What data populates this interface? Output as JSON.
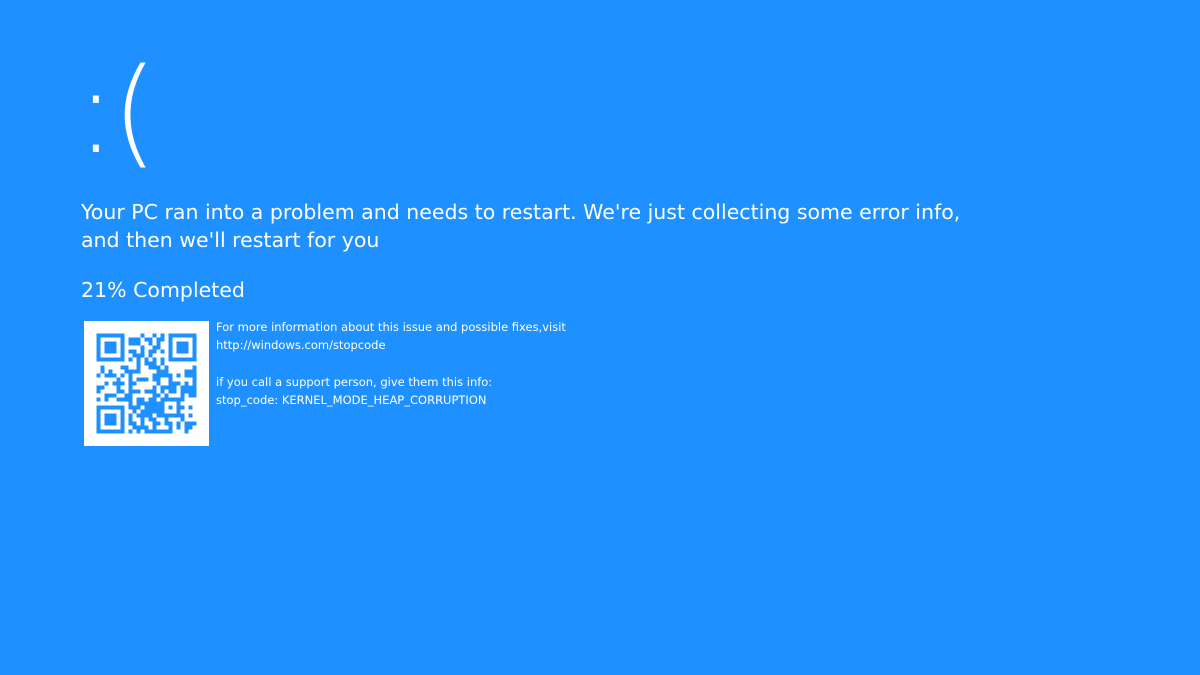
{
  "colors": {
    "background": "#1e90ff",
    "text": "#ffffff",
    "qr_background": "#ffffff",
    "qr_modules": "#1e90ff"
  },
  "screen": {
    "emoticon": ":(",
    "message": "Your PC ran into a problem and needs to restart. We're just collecting some error info, and then we'll restart for you",
    "progress": {
      "value": 21,
      "unit": "%",
      "label": "Completed"
    },
    "qr_code_icon": "qr-code-icon",
    "info": {
      "more_info": "For more information about this issue and possible fixes,visit",
      "url": "http://windows.com/stopcode",
      "support": "if you call a support person, give them this info:",
      "stop_code_label": "stop_code:",
      "stop_code": "KERNEL_MODE_HEAP_CORRUPTION"
    }
  }
}
